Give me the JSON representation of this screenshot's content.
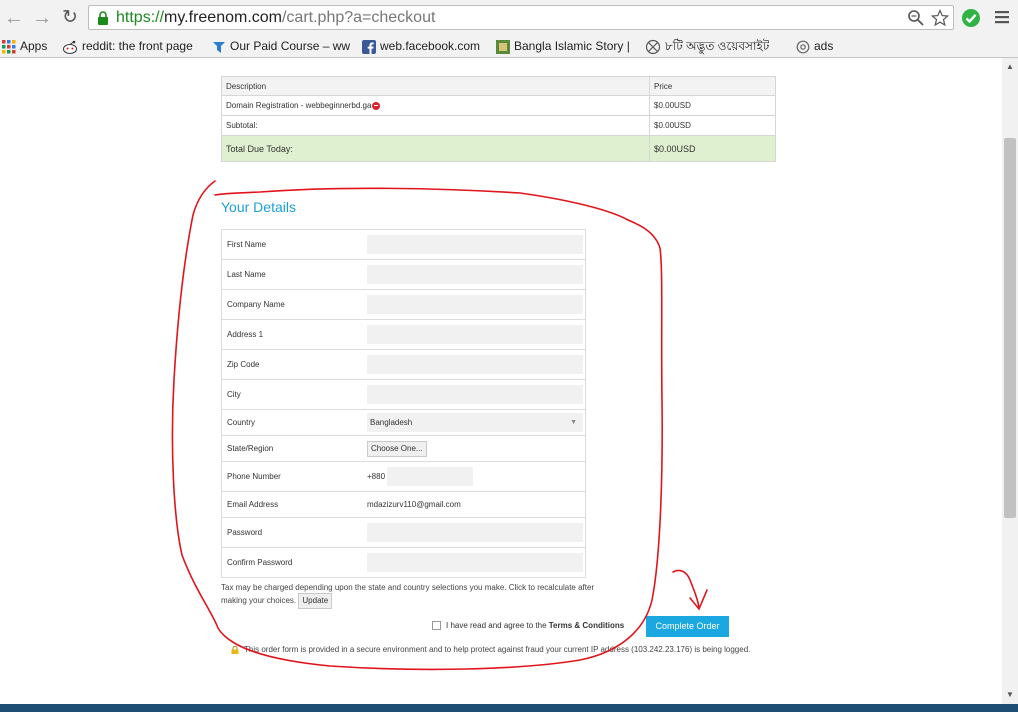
{
  "browser": {
    "url_scheme": "https://",
    "url_host": "my.freenom.com",
    "url_path": "/cart.php?a=checkout",
    "bookmarks": [
      {
        "label": "Apps",
        "icon": "apps-grid-icon"
      },
      {
        "label": "reddit: the front page",
        "icon": "reddit-icon"
      },
      {
        "label": "Our Paid Course – ww",
        "icon": "bookmark-site-icon"
      },
      {
        "label": "web.facebook.com",
        "icon": "facebook-icon"
      },
      {
        "label": "Bangla Islamic Story |",
        "icon": "bookmark-site-icon"
      },
      {
        "label": "৮টি অদ্ভুত ওয়েবসাইট",
        "icon": "globe-icon"
      },
      {
        "label": "ads",
        "icon": "globe-icon"
      }
    ],
    "colors": {
      "secure": "#1a8a1a",
      "extension": "#2fb344"
    }
  },
  "summary": {
    "headers": {
      "description": "Description",
      "price": "Price"
    },
    "rows": [
      {
        "description": "Domain Registration - webbeginnerbd.ga",
        "price": "$0.00USD"
      },
      {
        "description": "Subtotal:",
        "price": "$0.00USD"
      }
    ],
    "total": {
      "label": "Total Due Today:",
      "value": "$0.00USD"
    },
    "colors": {
      "total_bg": "#dff0d0"
    }
  },
  "details": {
    "title": "Your Details",
    "fields": {
      "first_name": {
        "label": "First Name",
        "value": ""
      },
      "last_name": {
        "label": "Last Name",
        "value": ""
      },
      "company": {
        "label": "Company Name",
        "value": ""
      },
      "address1": {
        "label": "Address 1",
        "value": ""
      },
      "zip": {
        "label": "Zip Code",
        "value": ""
      },
      "city": {
        "label": "City",
        "value": ""
      },
      "country": {
        "label": "Country",
        "value": "Bangladesh"
      },
      "state": {
        "label": "State/Region",
        "value": "Choose One..."
      },
      "phone": {
        "label": "Phone Number",
        "prefix": "+880",
        "value": ""
      },
      "email": {
        "label": "Email Address",
        "value": "mdazizurv110@gmail.com"
      },
      "password": {
        "label": "Password",
        "value": ""
      },
      "confirm_password": {
        "label": "Confirm Password",
        "value": ""
      }
    }
  },
  "footer": {
    "tax_note": "Tax may be charged depending upon the state and country selections you make. Click to recalculate after making your choices.",
    "update_label": "Update",
    "terms_prefix": "I have read and agree to the",
    "terms_link": "Terms & Conditions",
    "complete_label": "Complete Order",
    "secure_note": "This order form is provided in a secure environment and to help protect against fraud your current IP address (103.242.23.176) is being logged.",
    "colors": {
      "accent": "#1ba8e0",
      "title": "#1ba1d6",
      "annotation": "#e0141b"
    }
  }
}
